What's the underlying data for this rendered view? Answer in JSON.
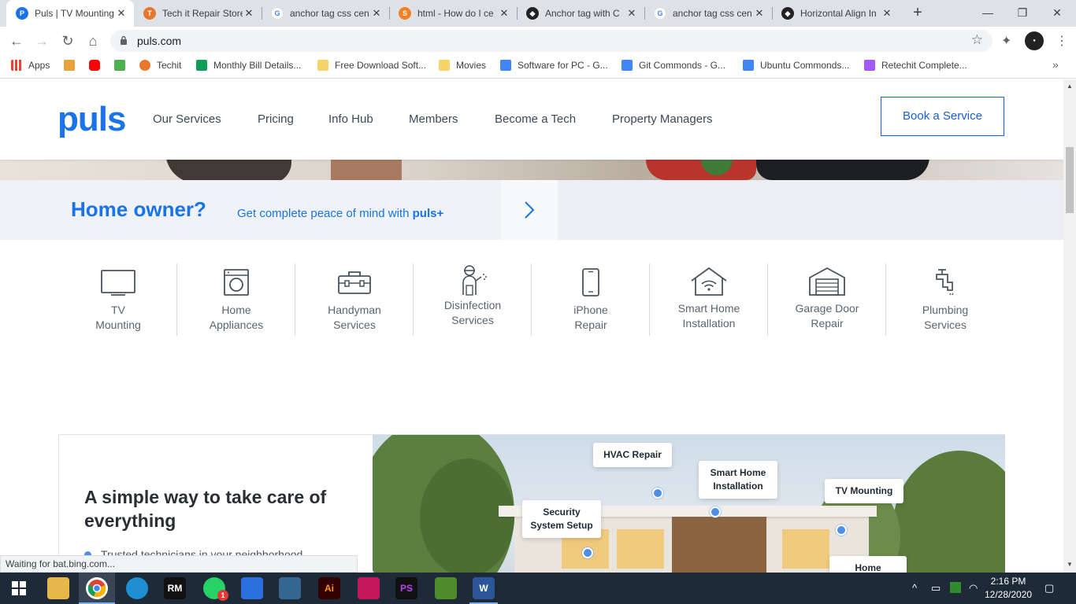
{
  "browser": {
    "tabs": [
      {
        "title": "Puls | TV Mounting",
        "active": true,
        "favicon_color": "#1a73e8",
        "favicon_letter": "P"
      },
      {
        "title": "Tech it Repair Store",
        "favicon_color": "#e8772e",
        "favicon_letter": "T"
      },
      {
        "title": "anchor tag css cen",
        "favicon_color": "#ffffff",
        "favicon_letter": "G"
      },
      {
        "title": "html - How do I ce",
        "favicon_color": "#f48024",
        "favicon_letter": "S"
      },
      {
        "title": "Anchor tag with C",
        "favicon_color": "#222222",
        "favicon_letter": "C"
      },
      {
        "title": "anchor tag css cen",
        "favicon_color": "#ffffff",
        "favicon_letter": "G"
      },
      {
        "title": "Horizontal Align In",
        "favicon_color": "#222222",
        "favicon_letter": "C"
      }
    ],
    "url": "puls.com",
    "bookmarks": [
      {
        "label": "Apps",
        "color": "#ea4335"
      },
      {
        "label": "",
        "color": "#e8a33a"
      },
      {
        "label": "",
        "color": "#ff0000"
      },
      {
        "label": "",
        "color": "#4caf50"
      },
      {
        "label": "Techit",
        "color": "#e8772e"
      },
      {
        "label": "Monthly Bill Details...",
        "color": "#0f9d58"
      },
      {
        "label": "Free Download Soft...",
        "color": "#f6d36b"
      },
      {
        "label": "Movies",
        "color": "#f6d36b"
      },
      {
        "label": "Software for PC - G...",
        "color": "#4285f4"
      },
      {
        "label": "Git Commonds - G...",
        "color": "#4285f4"
      },
      {
        "label": "Ubuntu Commonds...",
        "color": "#4285f4"
      },
      {
        "label": "Retechit Complete...",
        "color": "#a259ff"
      }
    ],
    "status": "Waiting for bat.bing.com..."
  },
  "site": {
    "logo": "puls",
    "nav": [
      "Our Services",
      "Pricing",
      "Info Hub",
      "Members",
      "Become a Tech",
      "Property Managers"
    ],
    "book_button": "Book a Service",
    "homeowner": {
      "title": "Home owner?",
      "subtitle_prefix": "Get complete peace of mind with ",
      "subtitle_brand": "puls+"
    },
    "services": [
      {
        "label": "TV\nMounting",
        "icon": "tv-icon"
      },
      {
        "label": "Home\nAppliances",
        "icon": "washing-machine-icon"
      },
      {
        "label": "Handyman\nServices",
        "icon": "toolbox-icon"
      },
      {
        "label": "Disinfection\nServices",
        "icon": "sprayer-icon"
      },
      {
        "label": "iPhone\nRepair",
        "icon": "phone-icon"
      },
      {
        "label": "Smart Home\nInstallation",
        "icon": "smart-home-icon"
      },
      {
        "label": "Garage Door\nRepair",
        "icon": "garage-icon"
      },
      {
        "label": "Plumbing\nServices",
        "icon": "faucet-icon"
      }
    ],
    "feature": {
      "title": "A simple way to take care of everything",
      "bullet": "Trusted technicians in your neighborhood",
      "callouts": {
        "hvac": "HVAC Repair",
        "smart_home": "Smart Home\nInstallation",
        "tv": "TV Mounting",
        "security": "Security\nSystem Setup",
        "home": "Home"
      }
    },
    "brand_color": "#1a73e8"
  },
  "taskbar": {
    "time": "2:16 PM",
    "date": "12/28/2020",
    "whatsapp_badge": "1"
  }
}
